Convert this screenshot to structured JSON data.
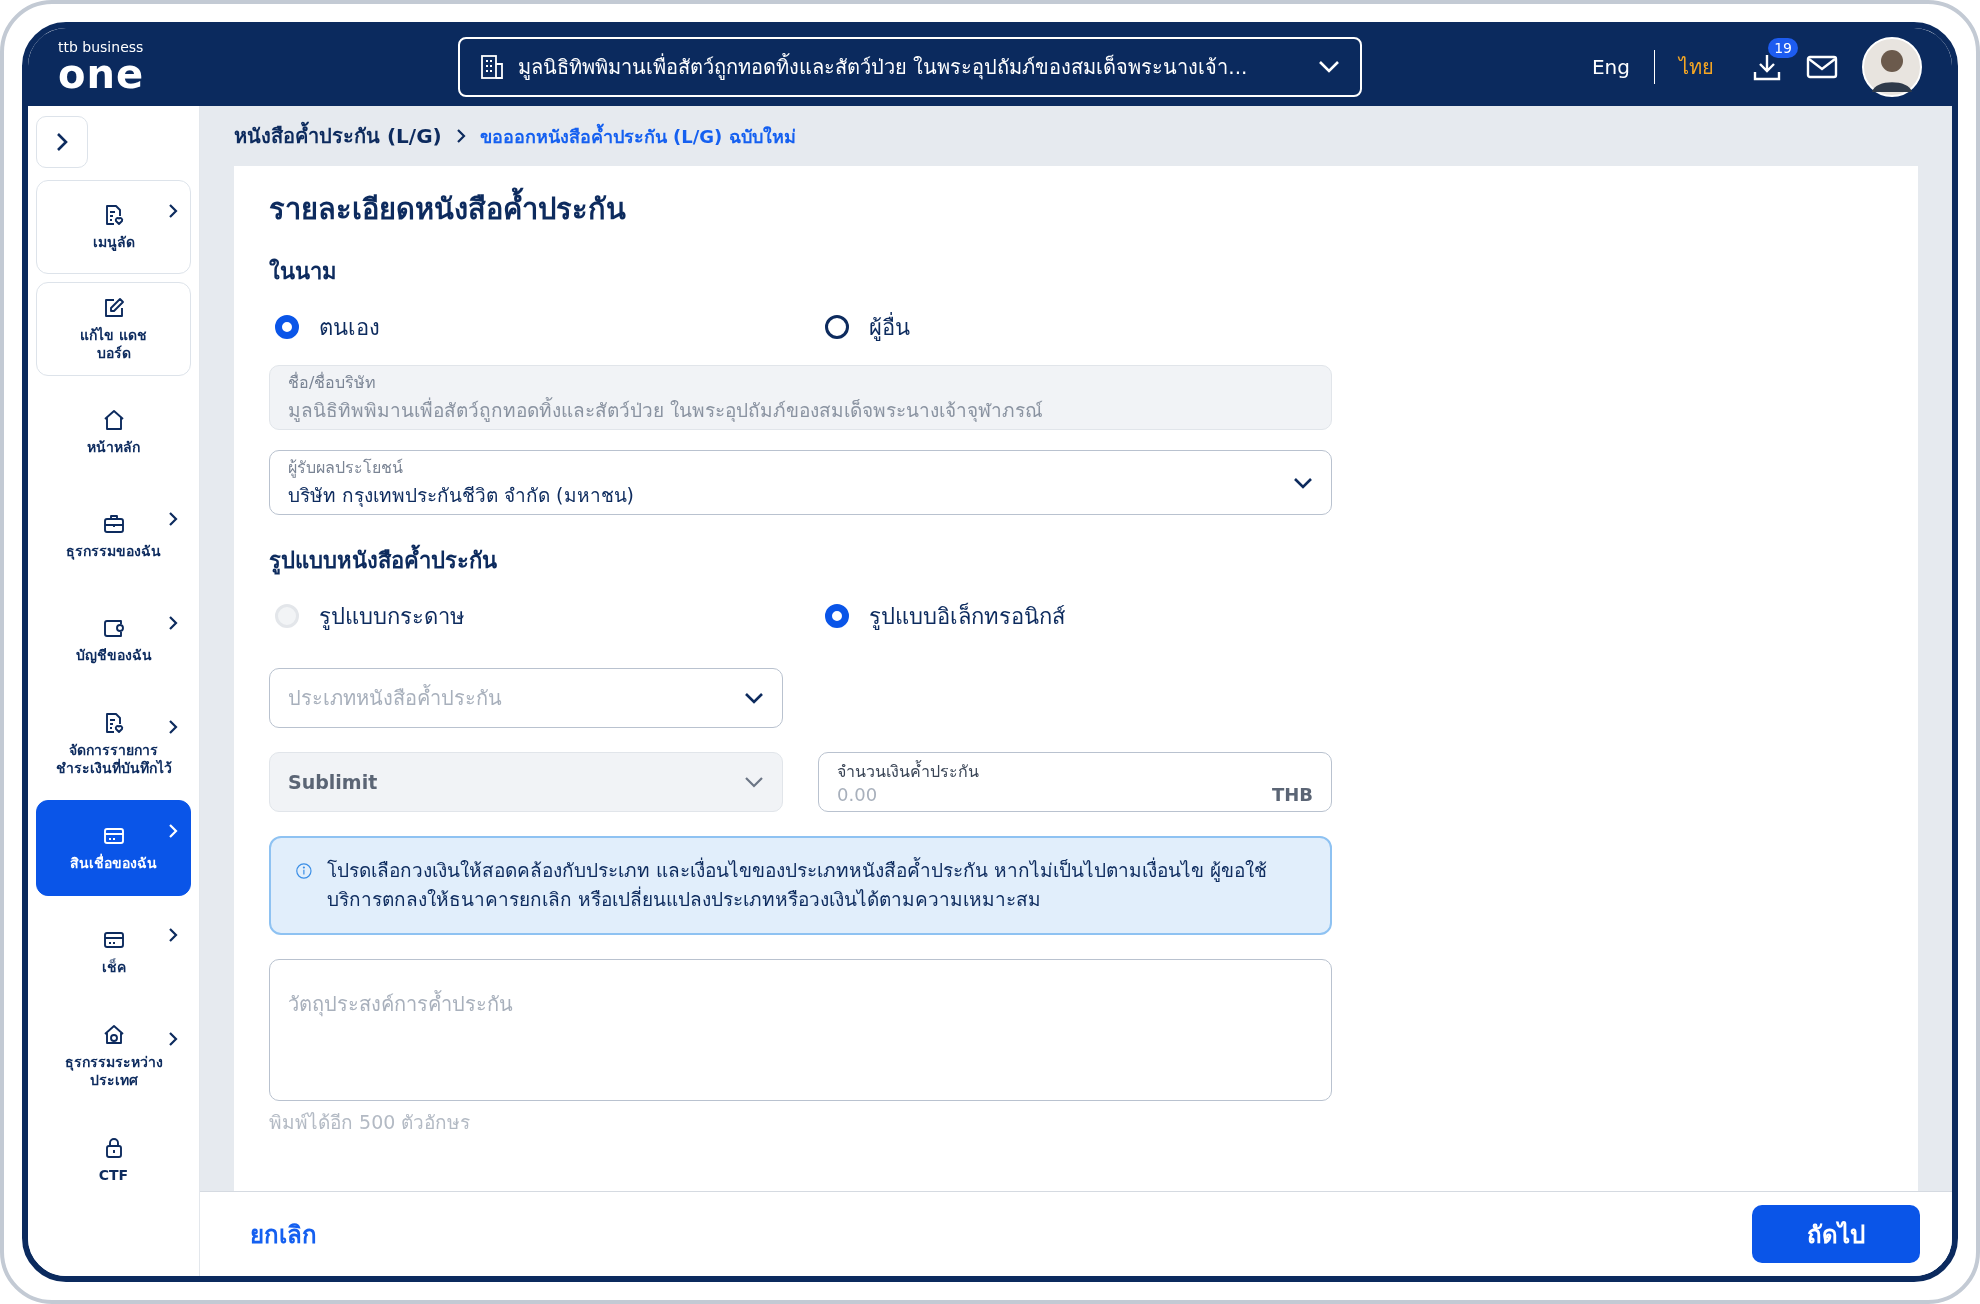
{
  "header": {
    "logo_top": "ttb business",
    "logo_main": "one",
    "company": "มูลนิธิทิพพิมานเพื่อสัตว์ถูกทอดทิ้งและสัตว์ป่วย ในพระอุปถัมภ์ของสมเด็จพระนางเจ้า...",
    "languages": [
      {
        "label": "Eng",
        "selected": false
      },
      {
        "label": "ไทย",
        "selected": true
      }
    ],
    "download_badge": "19"
  },
  "sidebar": {
    "items": [
      {
        "label": "เมนูลัด",
        "kind": "card",
        "submenu": true,
        "selected": false
      },
      {
        "label": "แก้ไข แดชบอร์ด",
        "kind": "card",
        "submenu": false,
        "selected": false
      },
      {
        "label": "หน้าหลัก",
        "kind": "link",
        "submenu": false,
        "selected": false
      },
      {
        "label": "ธุรกรรมของฉัน",
        "kind": "link",
        "submenu": true,
        "selected": false
      },
      {
        "label": "บัญชีของฉัน",
        "kind": "link",
        "submenu": true,
        "selected": false
      },
      {
        "label": "จัดการรายการชำระเงินที่บันทึกไว้",
        "kind": "link",
        "submenu": true,
        "selected": false
      },
      {
        "label": "สินเชื่อของฉัน",
        "kind": "link",
        "submenu": true,
        "selected": true
      },
      {
        "label": "เช็ค",
        "kind": "link",
        "submenu": true,
        "selected": false
      },
      {
        "label": "ธุรกรรมระหว่างประเทศ",
        "kind": "link",
        "submenu": true,
        "selected": false
      },
      {
        "label": "CTF",
        "kind": "link",
        "submenu": false,
        "selected": false
      }
    ]
  },
  "breadcrumb": [
    {
      "label": "หนังสือค้ำประกัน (L/G)",
      "current": false
    },
    {
      "label": "ขอออกหนังสือค้ำประกัน (L/G) ฉบับใหม่",
      "current": true
    }
  ],
  "form": {
    "title": "รายละเอียดหนังสือค้ำประกัน",
    "name_section": {
      "heading": "ในนาม",
      "options": [
        {
          "label": "ตนเอง",
          "selected": true,
          "disabled": false
        },
        {
          "label": "ผู้อื่น",
          "selected": false,
          "disabled": false
        }
      ]
    },
    "company_name": {
      "label": "ชื่อ/ชื่อบริษัท",
      "value": "มูลนิธิทิพพิมานเพื่อสัตว์ถูกทอดทิ้งและสัตว์ป่วย ในพระอุปถัมภ์ของสมเด็จพระนางเจ้าจุฬาภรณ์",
      "disabled": true
    },
    "beneficiary": {
      "label": "ผู้รับผลประโยชน์",
      "value": "บริษัท กรุงเทพประกันชีวิต จำกัด (มหาชน)",
      "disabled": false
    },
    "format_section": {
      "heading": "รูปแบบหนังสือค้ำประกัน",
      "options": [
        {
          "label": "รูปแบบกระดาษ",
          "selected": false,
          "disabled": true
        },
        {
          "label": "รูปแบบอิเล็กทรอนิกส์",
          "selected": true,
          "disabled": false
        }
      ]
    },
    "guarantee_type": {
      "placeholder": "ประเภทหนังสือค้ำประกัน",
      "disabled": false
    },
    "sublimit": {
      "value": "Sublimit",
      "disabled": true
    },
    "amount": {
      "label": "จำนวนเงินค้ำประกัน",
      "placeholder": "0.00",
      "currency": "THB"
    },
    "notice": "โปรดเลือกวงเงินให้สอดคล้องกับประเภท และเงื่อนไขของประเภทหนังสือค้ำประกัน หากไม่เป็นไปตามเงื่อนไข ผู้ขอใช้บริการตกลงให้ธนาคารยกเลิก หรือเปลี่ยนแปลงประเภทหรือวงเงินได้ตามความเหมาะสม",
    "purpose": {
      "placeholder": "วัตถุประสงค์การค้ำประกัน",
      "helper": "พิมพ์ได้อีก 500 ตัวอักษร"
    }
  },
  "footer": {
    "cancel": "ยกเลิก",
    "next": "ถัดไป"
  }
}
